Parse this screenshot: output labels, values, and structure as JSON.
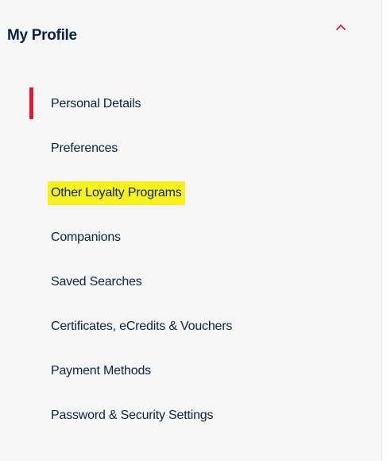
{
  "profile_menu": {
    "title": "My Profile",
    "collapse_icon": "chevron-up-icon",
    "accent_color": "#e01933",
    "highlight_color": "#f7f21f",
    "active_item": "Personal Details",
    "highlighted_item": "Other Loyalty Programs",
    "items": [
      {
        "label": "Personal Details"
      },
      {
        "label": "Preferences"
      },
      {
        "label": "Other Loyalty Programs"
      },
      {
        "label": "Companions"
      },
      {
        "label": "Saved Searches"
      },
      {
        "label": "Certificates, eCredits & Vouchers"
      },
      {
        "label": "Payment Methods"
      },
      {
        "label": "Password & Security Settings"
      }
    ]
  }
}
